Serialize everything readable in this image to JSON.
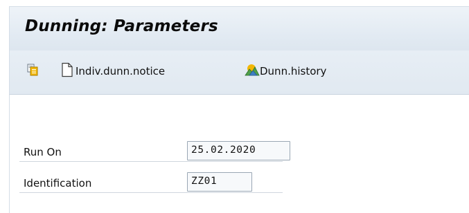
{
  "title": "Dunning: Parameters",
  "toolbar": {
    "copy": {
      "icon": "copy-icon"
    },
    "individual_notice": {
      "icon": "document-icon",
      "label": "Indiv.dunn.notice"
    },
    "history": {
      "icon": "mountain-chart-icon",
      "label": "Dunn.history"
    }
  },
  "form": {
    "run_on": {
      "label": "Run On",
      "value": "25.02.2020"
    },
    "identification": {
      "label": "Identification",
      "value": "ZZ01"
    }
  },
  "colors": {
    "header_bg": "#e3ebf3",
    "toolbar_bg": "#e4ecf3",
    "input_border": "#9aa7b4",
    "input_bg": "#f7f9fb",
    "icon_yellow": "#f2b705",
    "icon_blue": "#3d7fc4",
    "icon_green": "#4fa04a"
  }
}
